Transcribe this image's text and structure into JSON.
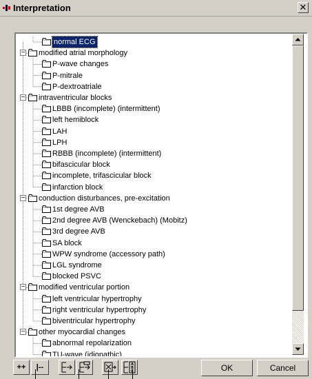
{
  "window": {
    "title": "Interpretation",
    "close_glyph": "✕",
    "app_icon": "app-icon"
  },
  "tree": {
    "items": [
      {
        "label": "normal ECG",
        "level": 1,
        "type": "leaf",
        "selected": true
      },
      {
        "label": "modified atrial morphology",
        "level": 0,
        "type": "group",
        "expanded": true
      },
      {
        "label": "P-wave changes",
        "level": 1,
        "type": "leaf"
      },
      {
        "label": "P-mitrale",
        "level": 1,
        "type": "leaf"
      },
      {
        "label": "P-dextroatriale",
        "level": 1,
        "type": "leaf"
      },
      {
        "label": "intraventricular blocks",
        "level": 0,
        "type": "group",
        "expanded": true
      },
      {
        "label": "LBBB (incomplete) (intermittent)",
        "level": 1,
        "type": "leaf"
      },
      {
        "label": "left hemiblock",
        "level": 1,
        "type": "leaf"
      },
      {
        "label": "LAH",
        "level": 1,
        "type": "leaf"
      },
      {
        "label": "LPH",
        "level": 1,
        "type": "leaf"
      },
      {
        "label": "RBBB (incomplete) (intermittent)",
        "level": 1,
        "type": "leaf"
      },
      {
        "label": "bifascicular block",
        "level": 1,
        "type": "leaf"
      },
      {
        "label": "incomplete, trifascicular block",
        "level": 1,
        "type": "leaf"
      },
      {
        "label": "infarction block",
        "level": 1,
        "type": "leaf"
      },
      {
        "label": "conduction disturbances, pre-excitation",
        "level": 0,
        "type": "group",
        "expanded": true
      },
      {
        "label": "1st degree AVB",
        "level": 1,
        "type": "leaf"
      },
      {
        "label": "2nd degree AVB (Wenckebach) (Mobitz)",
        "level": 1,
        "type": "leaf"
      },
      {
        "label": "3rd degree AVB",
        "level": 1,
        "type": "leaf"
      },
      {
        "label": "SA block",
        "level": 1,
        "type": "leaf"
      },
      {
        "label": "WPW syndrome (accessory path)",
        "level": 1,
        "type": "leaf"
      },
      {
        "label": "LGL syndrome",
        "level": 1,
        "type": "leaf"
      },
      {
        "label": "blocked PSVC",
        "level": 1,
        "type": "leaf"
      },
      {
        "label": "modified ventricular portion",
        "level": 0,
        "type": "group",
        "expanded": true
      },
      {
        "label": "left ventricular hypertrophy",
        "level": 1,
        "type": "leaf"
      },
      {
        "label": "right ventricular hypertrophy",
        "level": 1,
        "type": "leaf"
      },
      {
        "label": "biventricular hypertrophy",
        "level": 1,
        "type": "leaf"
      },
      {
        "label": "other myocardial changes",
        "level": 0,
        "type": "group",
        "expanded": true
      },
      {
        "label": "abnormal repolarization",
        "level": 1,
        "type": "leaf"
      },
      {
        "label": "TU-wave (idiopathic)",
        "level": 1,
        "type": "leaf"
      }
    ],
    "expander_glyph": "−",
    "folder_icon": "folder-icon"
  },
  "scrollbar": {
    "position_fraction": 0.0,
    "up_icon": "scroll-up-arrow-icon",
    "down_icon": "scroll-down-arrow-icon"
  },
  "toolbar": {
    "expand_all_label": "++",
    "collapse_all_label": "|--",
    "icons": [
      "insert-after-icon",
      "insert-before-icon",
      "delete-item-icon",
      "sort-abc-icon"
    ]
  },
  "buttons": {
    "ok_label": "OK",
    "cancel_label": "Cancel"
  }
}
